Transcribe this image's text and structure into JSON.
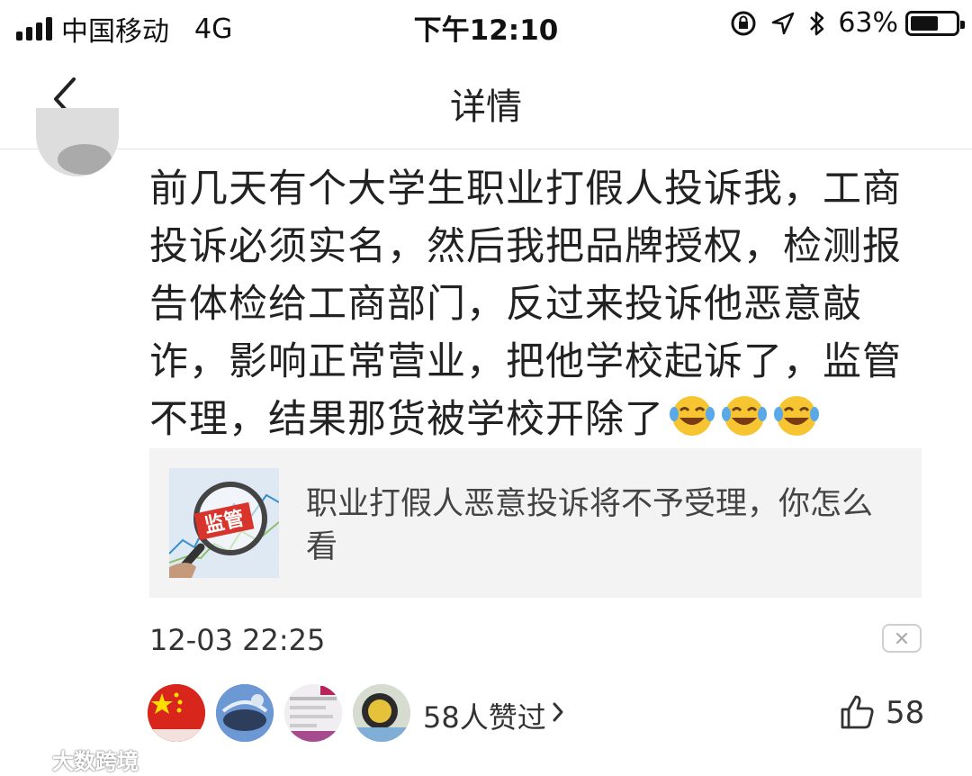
{
  "status_bar": {
    "carrier": "中国移动",
    "network": "4G",
    "time": "下午12:10",
    "battery_percent": "63%",
    "battery_level": 0.63
  },
  "nav": {
    "title": "详情",
    "back_icon": "chevron-left-icon"
  },
  "comment": {
    "text": "前几天有个大学生职业打假人投诉我，工商投诉必须实名，然后我把品牌授权，检测报告体检给工商部门，反过来投诉他恶意敲诈，影响正常营业，把他学校起诉了，监管不理，结果那货被学校开除了",
    "emoji_icons": [
      "laughing-crying-emoji-icon",
      "laughing-crying-emoji-icon",
      "laughing-crying-emoji-icon"
    ],
    "timestamp": "12-03 22:25"
  },
  "article": {
    "thumb_label": "监管",
    "title": "职业打假人恶意投诉将不予受理，你怎么看"
  },
  "likes": {
    "liked_by": "58人赞过",
    "count": "58",
    "avatars": [
      "flag-avatar",
      "blue-avatar",
      "document-avatar",
      "photo-avatar"
    ]
  },
  "watermark": {
    "text": "大数跨境"
  }
}
